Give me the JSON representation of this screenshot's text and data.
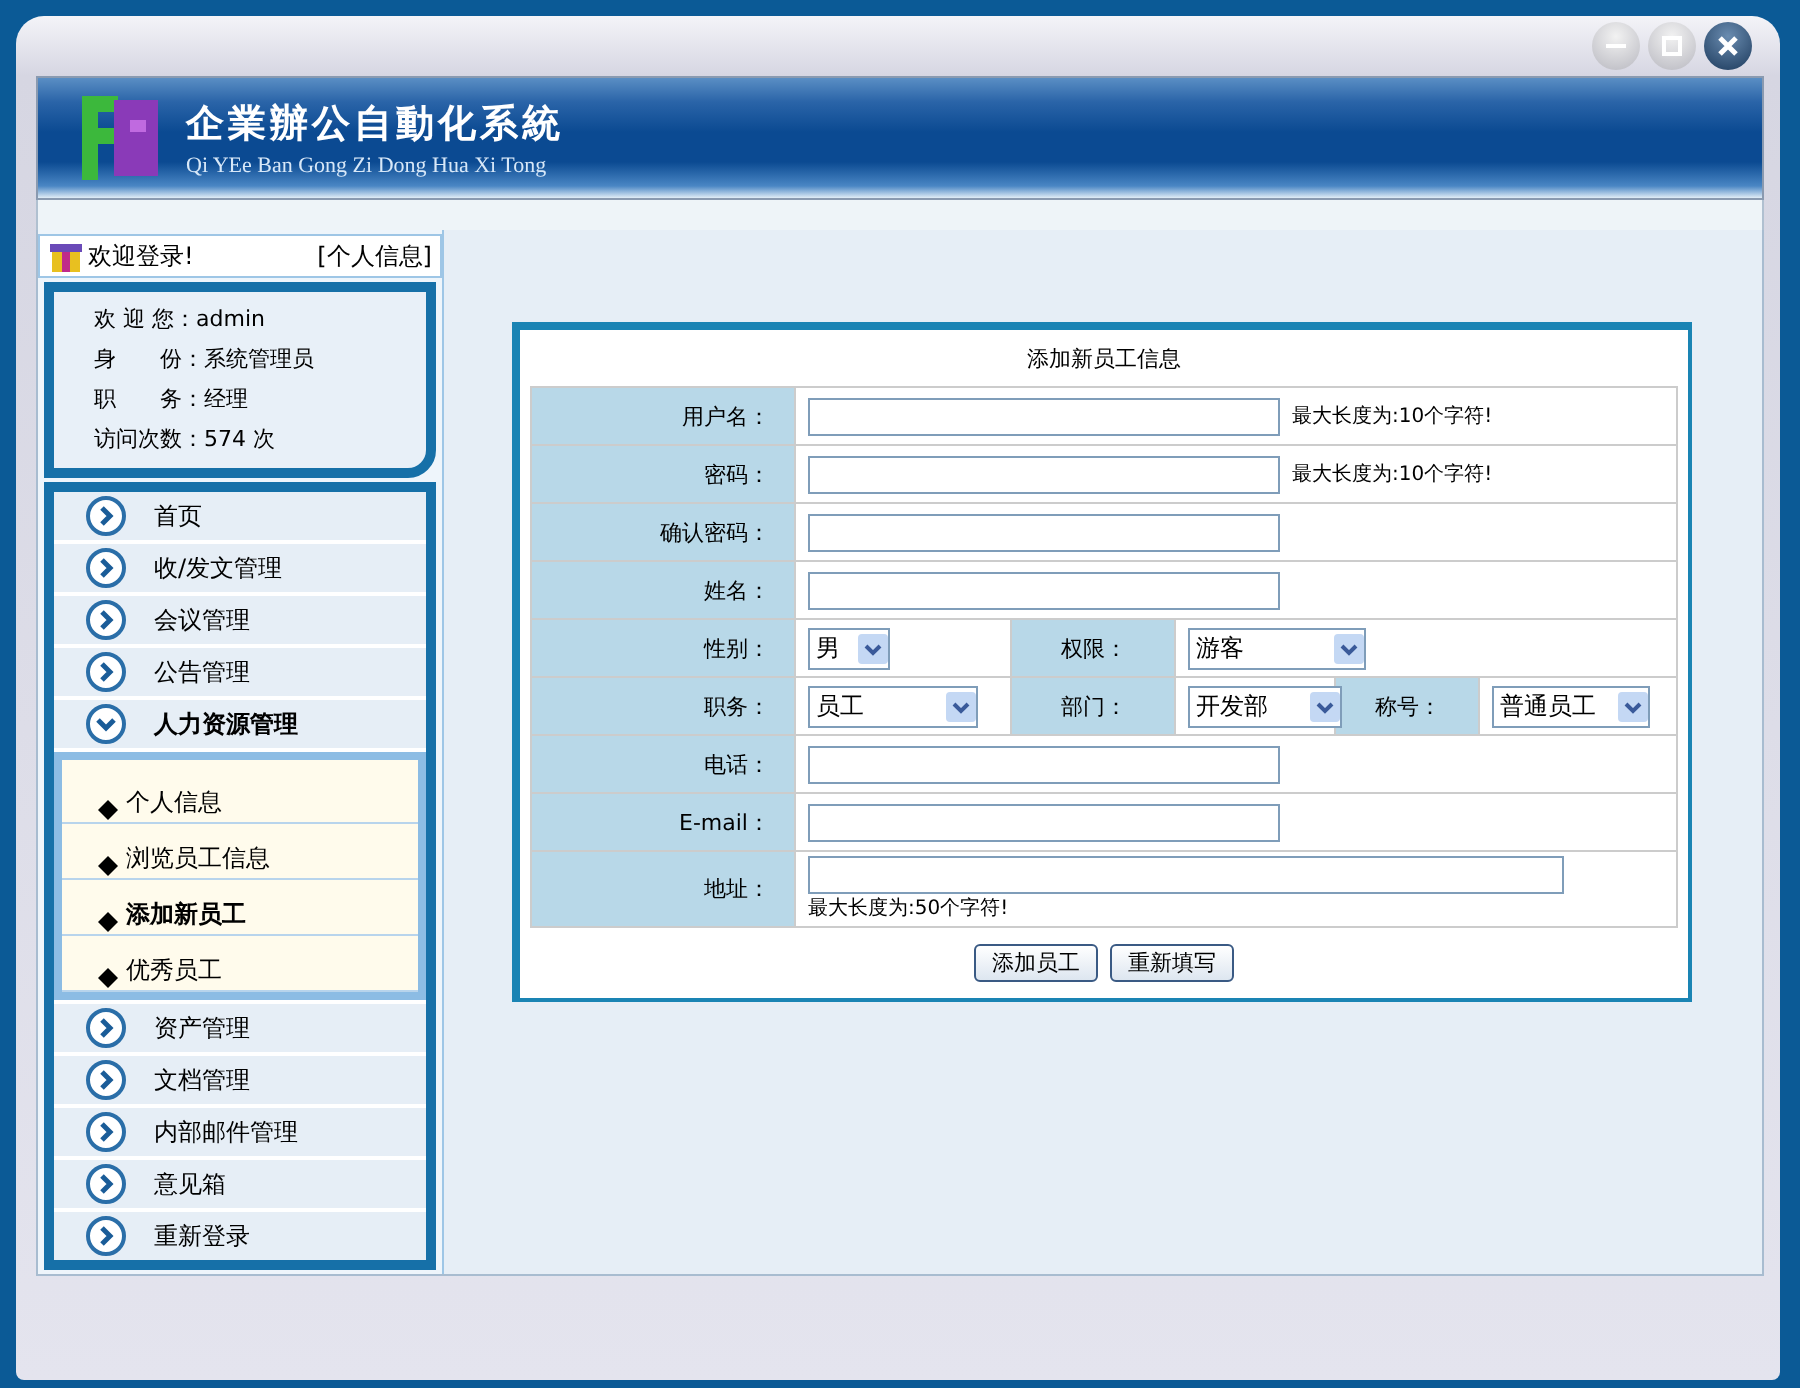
{
  "app": {
    "title": "企業辦公自動化系統",
    "subtitle": "Qi YEe Ban Gong Zi Dong Hua Xi Tong"
  },
  "sidebar": {
    "greeting": "欢迎登录!",
    "profile_link": "[个人信息]",
    "info": [
      {
        "label": "欢 迎 您：",
        "value": "admin"
      },
      {
        "label": "身　　份：",
        "value": "系统管理员"
      },
      {
        "label": "职　　务：",
        "value": "经理"
      },
      {
        "label": "访问次数：",
        "value": "574 次"
      }
    ],
    "menu": [
      {
        "label": "首页",
        "expanded": false
      },
      {
        "label": "收/发文管理",
        "expanded": false
      },
      {
        "label": "会议管理",
        "expanded": false
      },
      {
        "label": "公告管理",
        "expanded": false
      },
      {
        "label": "人力资源管理",
        "expanded": true,
        "children": [
          {
            "label": "个人信息",
            "selected": false
          },
          {
            "label": "浏览员工信息",
            "selected": false
          },
          {
            "label": "添加新员工",
            "selected": true
          },
          {
            "label": "优秀员工",
            "selected": false
          }
        ]
      },
      {
        "label": "资产管理",
        "expanded": false
      },
      {
        "label": "文档管理",
        "expanded": false
      },
      {
        "label": "内部邮件管理",
        "expanded": false
      },
      {
        "label": "意见箱",
        "expanded": false
      },
      {
        "label": "重新登录",
        "expanded": false
      }
    ]
  },
  "form": {
    "title": "添加新员工信息",
    "rows": [
      {
        "kind": "text",
        "label": "用户名：",
        "note": "最大长度为:10个字符!"
      },
      {
        "kind": "text",
        "label": "密码：",
        "note": "最大长度为:10个字符!"
      },
      {
        "kind": "text",
        "label": "确认密码："
      },
      {
        "kind": "text",
        "label": "姓名："
      },
      {
        "kind": "selects",
        "cells": [
          {
            "label": "性别：",
            "value": "男"
          },
          {
            "label": "权限：",
            "value": "游客"
          }
        ]
      },
      {
        "kind": "selects",
        "cells": [
          {
            "label": "职务：",
            "value": "员工"
          },
          {
            "label": "部门：",
            "value": "开发部"
          },
          {
            "label": "称号：",
            "value": "普通员工"
          }
        ]
      },
      {
        "kind": "text",
        "label": "电话："
      },
      {
        "kind": "text",
        "label": "E-mail："
      },
      {
        "kind": "wide",
        "label": "地址：",
        "note": "最大长度为:50个字符!"
      }
    ],
    "buttons": [
      "添加员工",
      "重新填写"
    ]
  }
}
